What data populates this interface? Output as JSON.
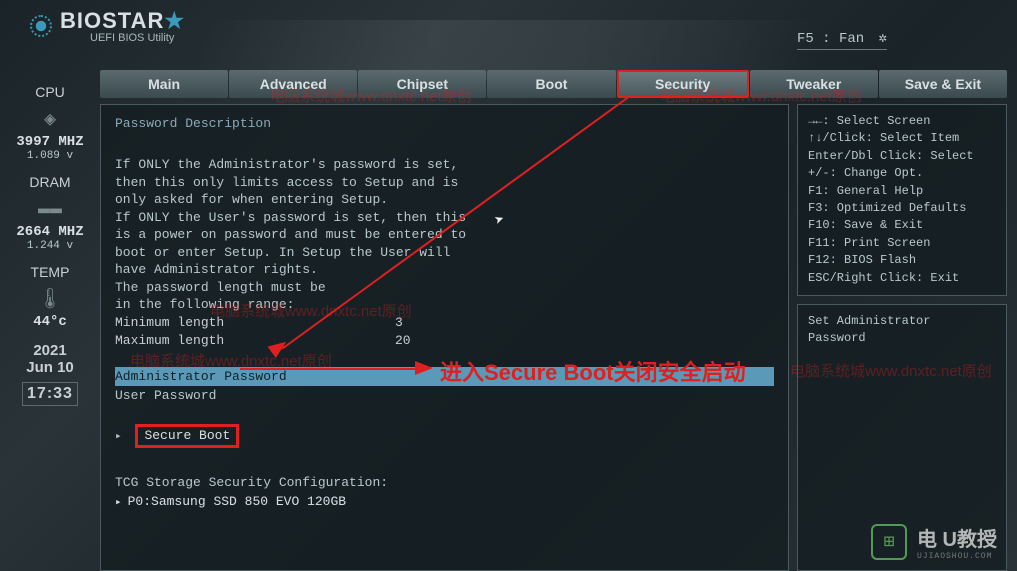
{
  "brand": {
    "name": "BIOSTAR",
    "subtitle": "UEFI BIOS Utility"
  },
  "header": {
    "fan_label": "F5 : Fan",
    "fan_icon": "✲"
  },
  "tabs": [
    "Main",
    "Advanced",
    "Chipset",
    "Boot",
    "Security",
    "Tweaker",
    "Save & Exit"
  ],
  "active_tab_index": 4,
  "left_rail": {
    "cpu": {
      "title": "CPU",
      "value": "3997 MHZ",
      "sub": "1.089 v"
    },
    "dram": {
      "title": "DRAM",
      "value": "2664 MHZ",
      "sub": "1.244 v"
    },
    "temp": {
      "title": "TEMP",
      "value": "44°c"
    },
    "date": {
      "year": "2021",
      "month_day": "Jun 10",
      "time": "17:33"
    }
  },
  "content": {
    "desc_title": "Password Description",
    "desc_text": "If ONLY the Administrator's password is set,\nthen this only limits access to Setup and is\nonly asked for when entering Setup.\nIf ONLY the User's password is set, then this\nis a power on password and must be entered to\nboot or enter Setup. In Setup the User will\nhave Administrator rights.\nThe password length must be\nin the following range:",
    "min_label": "Minimum length",
    "min_value": "3",
    "max_label": "Maximum length",
    "max_value": "20",
    "admin_pw": "Administrator Password",
    "user_pw": "User Password",
    "secure_boot": "Secure Boot",
    "tcg_label": "TCG Storage Security Configuration:",
    "storage": "P0:Samsung SSD 850 EVO 120GB"
  },
  "help": [
    "→←: Select Screen",
    "↑↓/Click: Select Item",
    "Enter/Dbl Click: Select",
    "+/-: Change Opt.",
    "F1: General Help",
    "F3: Optimized Defaults",
    "F10: Save & Exit",
    "F11: Print Screen",
    "F12: BIOS Flash",
    "ESC/Right Click: Exit"
  ],
  "info": {
    "line1": "Set Administrator",
    "line2": "Password"
  },
  "annotation": {
    "text": "进入Secure Boot关闭安全启动"
  },
  "watermarks": [
    "电脑系统城www.dnxtc.net原创",
    "电脑系统城www.dnxtc.net原创",
    "电脑系统城www.dnxtc.net原创",
    "电脑系统城www.dnxtc.net原创",
    "电脑系统城www.dnxtc.net原创"
  ],
  "bottom_logo": {
    "text1": "电",
    "text2": "U教授",
    "sub": "UJIAOSHOU.COM"
  }
}
